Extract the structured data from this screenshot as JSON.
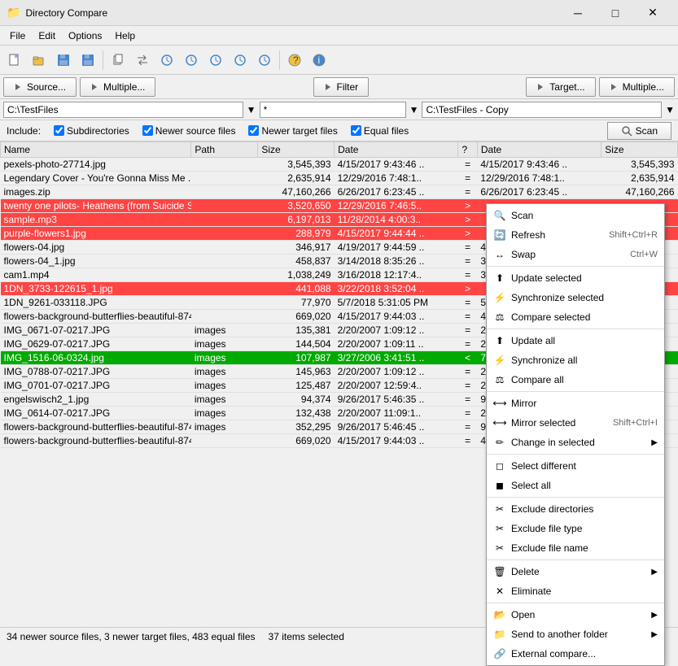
{
  "app": {
    "title": "Directory Compare",
    "icon": "📁"
  },
  "titlebar": {
    "minimize": "─",
    "maximize": "□",
    "close": "✕"
  },
  "menu": {
    "items": [
      "File",
      "Edit",
      "Options",
      "Help"
    ]
  },
  "panel_buttons": {
    "source_label": "Source...",
    "multiple1_label": "Multiple...",
    "filter_label": "Filter",
    "target_label": "Target...",
    "multiple2_label": "Multiple..."
  },
  "paths": {
    "left": "C:\\TestFiles",
    "filter": "*",
    "right": "C:\\TestFiles - Copy"
  },
  "options": {
    "include_label": "Include:",
    "subdirectories": "Subdirectories",
    "newer_source": "Newer source files",
    "newer_target": "Newer target files",
    "equal_files": "Equal files",
    "scan_label": "Scan"
  },
  "columns": {
    "name": "Name",
    "path": "Path",
    "size_l": "Size",
    "date_l": "Date",
    "sym": "?",
    "date_r": "Date",
    "size_r": "Size"
  },
  "files": [
    {
      "name": "pexels-photo-27714.jpg",
      "path": "",
      "size_l": "3,545,393",
      "date_l": "4/15/2017 9:43:46 ..",
      "sym": "=",
      "date_r": "4/15/2017 9:43:46 ..",
      "size_r": "3,545,393",
      "style": "normal"
    },
    {
      "name": "Legendary Cover - You're Gonna Miss Me ...",
      "path": "",
      "size_l": "2,635,914",
      "date_l": "12/29/2016 7:48:1..",
      "sym": "=",
      "date_r": "12/29/2016 7:48:1..",
      "size_r": "2,635,914",
      "style": "normal"
    },
    {
      "name": "images.zip",
      "path": "",
      "size_l": "47,160,266",
      "date_l": "6/26/2017 6:23:45 ..",
      "sym": "=",
      "date_r": "6/26/2017 6:23:45 ..",
      "size_r": "47,160,266",
      "style": "normal"
    },
    {
      "name": "twenty one pilots- Heathens (from Suicide S...",
      "path": "",
      "size_l": "3,520,650",
      "date_l": "12/29/2016 7:46:5..",
      "sym": ">",
      "date_r": "",
      "size_r": "",
      "style": "red"
    },
    {
      "name": "sample.mp3",
      "path": "",
      "size_l": "6,197,013",
      "date_l": "11/28/2014 4:00:3..",
      "sym": ">",
      "date_r": "",
      "size_r": "",
      "style": "red"
    },
    {
      "name": "purple-flowers1.jpg",
      "path": "",
      "size_l": "288,979",
      "date_l": "4/15/2017 9:44:44 ..",
      "sym": ">",
      "date_r": "",
      "size_r": "",
      "style": "red"
    },
    {
      "name": "flowers-04.jpg",
      "path": "",
      "size_l": "346,917",
      "date_l": "4/19/2017 9:44:59 ..",
      "sym": "=",
      "date_r": "4/15/2017 9:44:5..",
      "size_r": "",
      "style": "normal"
    },
    {
      "name": "flowers-04_1.jpg",
      "path": "",
      "size_l": "458,837",
      "date_l": "3/14/2018 8:35:26 ..",
      "sym": "=",
      "date_r": "3/14/2018 8:35:2..",
      "size_r": "",
      "style": "normal"
    },
    {
      "name": "cam1.mp4",
      "path": "",
      "size_l": "1,038,249",
      "date_l": "3/16/2018 12:17:4..",
      "sym": "=",
      "date_r": "3/16/2018 12:17..",
      "size_r": "",
      "style": "normal"
    },
    {
      "name": "1DN_3733-122615_1.jpg",
      "path": "",
      "size_l": "441,088",
      "date_l": "3/22/2018 3:52:04 ..",
      "sym": ">",
      "date_r": "",
      "size_r": "",
      "style": "red"
    },
    {
      "name": "1DN_9261-033118.JPG",
      "path": "",
      "size_l": "77,970",
      "date_l": "5/7/2018 5:31:05 PM",
      "sym": "=",
      "date_r": "5/7/2018 5:31:05..",
      "size_r": "",
      "style": "normal"
    },
    {
      "name": "flowers-background-butterflies-beautiful-874...",
      "path": "",
      "size_l": "669,020",
      "date_l": "4/15/2017 9:44:03 ..",
      "sym": "=",
      "date_r": "4/15/2017 9:44:0..",
      "size_r": "",
      "style": "normal"
    },
    {
      "name": "IMG_0671-07-0217.JPG",
      "path": "images",
      "size_l": "135,381",
      "date_l": "2/20/2007 1:09:12 ..",
      "sym": "=",
      "date_r": "2/20/2007 1:09:1..",
      "size_r": "",
      "style": "normal"
    },
    {
      "name": "IMG_0629-07-0217.JPG",
      "path": "images",
      "size_l": "144,504",
      "date_l": "2/20/2007 1:09:11 ..",
      "sym": "=",
      "date_r": "2/20/2007 1:09:1..",
      "size_r": "",
      "style": "normal"
    },
    {
      "name": "IMG_1516-06-0324.jpg",
      "path": "images",
      "size_l": "107,987",
      "date_l": "3/27/2006 3:41:51 ..",
      "sym": "<",
      "date_r": "7/24/2018 10:31..",
      "size_r": "",
      "style": "green"
    },
    {
      "name": "IMG_0788-07-0217.JPG",
      "path": "images",
      "size_l": "145,963",
      "date_l": "2/20/2007 1:09:12 ..",
      "sym": "=",
      "date_r": "2/20/2007 1:09:1..",
      "size_r": "",
      "style": "normal"
    },
    {
      "name": "IMG_0701-07-0217.JPG",
      "path": "images",
      "size_l": "125,487",
      "date_l": "2/20/2007 12:59:4..",
      "sym": "=",
      "date_r": "2/20/2007 12:59..",
      "size_r": "",
      "style": "normal"
    },
    {
      "name": "engelswisch2_1.jpg",
      "path": "images",
      "size_l": "94,374",
      "date_l": "9/26/2017 5:46:35 ..",
      "sym": "=",
      "date_r": "9/26/2017 5:46:3..",
      "size_r": "",
      "style": "normal"
    },
    {
      "name": "IMG_0614-07-0217.JPG",
      "path": "images",
      "size_l": "132,438",
      "date_l": "2/20/2007 11:09:1..",
      "sym": "=",
      "date_r": "2/20/2007 11:09..",
      "size_r": "",
      "style": "normal"
    },
    {
      "name": "flowers-background-butterflies-beautiful-874...",
      "path": "images",
      "size_l": "352,295",
      "date_l": "9/26/2017 5:46:45 ..",
      "sym": "=",
      "date_r": "9/26/2017 5:46:4..",
      "size_r": "",
      "style": "normal"
    },
    {
      "name": "flowers-background-butterflies-beautiful-874...",
      "path": "",
      "size_l": "669,020",
      "date_l": "4/15/2017 9:44:03 ..",
      "sym": "=",
      "date_r": "4/15/2017 9:44:0..",
      "size_r": "",
      "style": "normal"
    }
  ],
  "status": {
    "text": "34 newer source files, 3 newer target files, 483 equal files",
    "selected": "37 items selected"
  },
  "context_menu": {
    "items": [
      {
        "label": "Scan",
        "shortcut": "",
        "icon": "scan",
        "submenu": false
      },
      {
        "label": "Refresh",
        "shortcut": "Shift+Ctrl+R",
        "icon": "refresh",
        "submenu": false
      },
      {
        "label": "Swap",
        "shortcut": "Ctrl+W",
        "icon": "swap",
        "submenu": false
      },
      {
        "sep": true
      },
      {
        "label": "Update selected",
        "shortcut": "",
        "icon": "update",
        "submenu": false
      },
      {
        "label": "Synchronize selected",
        "shortcut": "",
        "icon": "sync",
        "submenu": false
      },
      {
        "label": "Compare selected",
        "shortcut": "",
        "icon": "compare",
        "submenu": false
      },
      {
        "sep": true
      },
      {
        "label": "Update all",
        "shortcut": "",
        "icon": "update",
        "submenu": false
      },
      {
        "label": "Synchronize all",
        "shortcut": "",
        "icon": "sync",
        "submenu": false
      },
      {
        "label": "Compare all",
        "shortcut": "",
        "icon": "compare",
        "submenu": false
      },
      {
        "sep": true
      },
      {
        "label": "Mirror",
        "shortcut": "",
        "icon": "mirror",
        "submenu": false
      },
      {
        "label": "Mirror selected",
        "shortcut": "Shift+Ctrl+I",
        "icon": "mirror",
        "submenu": false
      },
      {
        "label": "Change in selected",
        "shortcut": "",
        "icon": "change",
        "submenu": true
      },
      {
        "sep": true
      },
      {
        "label": "Select different",
        "shortcut": "",
        "icon": "select",
        "submenu": false
      },
      {
        "label": "Select all",
        "shortcut": "",
        "icon": "selectall",
        "submenu": false
      },
      {
        "sep": true
      },
      {
        "label": "Exclude directories",
        "shortcut": "",
        "icon": "exclude",
        "submenu": false
      },
      {
        "label": "Exclude file type",
        "shortcut": "",
        "icon": "exclude",
        "submenu": false
      },
      {
        "label": "Exclude file name",
        "shortcut": "",
        "icon": "exclude",
        "submenu": false
      },
      {
        "sep": true
      },
      {
        "label": "Delete",
        "shortcut": "",
        "icon": "delete",
        "submenu": true
      },
      {
        "label": "Eliminate",
        "shortcut": "",
        "icon": "eliminate",
        "submenu": false
      },
      {
        "sep": true
      },
      {
        "label": "Open",
        "shortcut": "",
        "icon": "open",
        "submenu": true
      },
      {
        "label": "Send to another folder",
        "shortcut": "",
        "icon": "send",
        "submenu": true
      },
      {
        "label": "External compare...",
        "shortcut": "",
        "icon": "ext",
        "submenu": false
      }
    ]
  }
}
